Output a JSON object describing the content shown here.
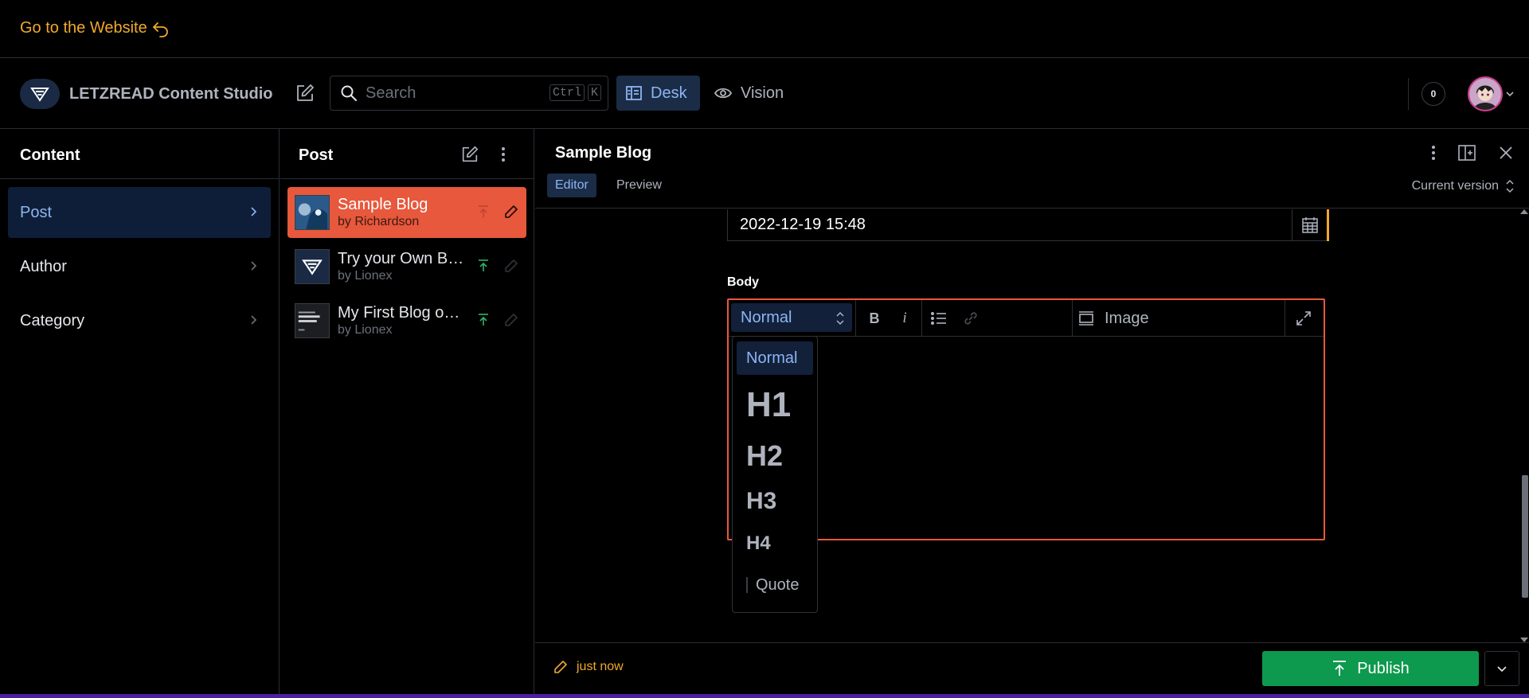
{
  "banner": {
    "link_label": "Go to the Website"
  },
  "navbar": {
    "brand_title": "LETZREAD Content Studio",
    "search_placeholder": "Search",
    "search_kbd": [
      "Ctrl",
      "K"
    ],
    "desk_label": "Desk",
    "vision_label": "Vision",
    "notification_count": "0"
  },
  "content_pane": {
    "title": "Content",
    "items": [
      {
        "label": "Post",
        "active": true
      },
      {
        "label": "Author",
        "active": false
      },
      {
        "label": "Category",
        "active": false
      }
    ]
  },
  "post_pane": {
    "title": "Post",
    "items": [
      {
        "title": "Sample Blog",
        "subtitle": "by Richardson",
        "active": true
      },
      {
        "title": "Try your Own Blog",
        "subtitle": "by Lionex",
        "active": false
      },
      {
        "title": "My First Blog on Sanity",
        "subtitle": "by Lionex",
        "active": false
      }
    ]
  },
  "document": {
    "title": "Sample Blog",
    "tabs": {
      "editor": "Editor",
      "preview": "Preview"
    },
    "version_label": "Current version",
    "date_value": "2022-12-19 15:48",
    "body_label": "Body",
    "toolbar": {
      "style_value": "Normal",
      "bold": "B",
      "italic": "i",
      "image_label": "Image"
    },
    "style_options": [
      "Normal",
      "H1",
      "H2",
      "H3",
      "H4",
      "Quote"
    ],
    "status_text": "just now",
    "publish_label": "Publish"
  },
  "colors": {
    "accent_orange": "#f0a92c",
    "selected_post": "#e7583c",
    "publish_green": "#0e9a4e",
    "selection_blue": "#8db5f2",
    "bottom_strip": "#4b1fa0"
  }
}
